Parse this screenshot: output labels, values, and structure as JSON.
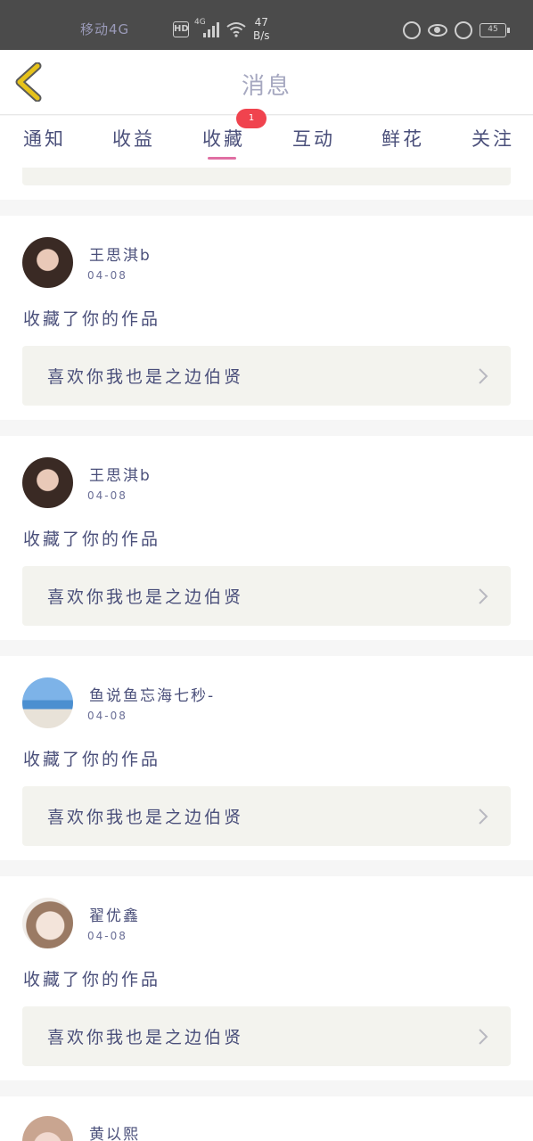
{
  "status_bar": {
    "carrier": "移动4G",
    "hd": "HD",
    "network": "4G",
    "speed_value": "47",
    "speed_unit": "B/s",
    "battery": "45"
  },
  "header": {
    "title": "消息"
  },
  "tabs": [
    {
      "label": "通知"
    },
    {
      "label": "收益"
    },
    {
      "label": "收藏",
      "active": true,
      "badge": "1"
    },
    {
      "label": "互动"
    },
    {
      "label": "鲜花"
    },
    {
      "label": "关注"
    }
  ],
  "cards": [
    {
      "username": "王思淇b",
      "date": "04-08",
      "action": "收藏了你的作品",
      "work_title": "喜欢你我也是之边伯贤"
    },
    {
      "username": "王思淇b",
      "date": "04-08",
      "action": "收藏了你的作品",
      "work_title": "喜欢你我也是之边伯贤"
    },
    {
      "username": "鱼说鱼忘海七秒-",
      "date": "04-08",
      "action": "收藏了你的作品",
      "work_title": "喜欢你我也是之边伯贤"
    },
    {
      "username": "翟优鑫",
      "date": "04-08",
      "action": "收藏了你的作品",
      "work_title": "喜欢你我也是之边伯贤"
    },
    {
      "username": "黄以熙"
    }
  ],
  "colors": {
    "accent_underline": "#e06fa3",
    "badge": "#f0434e",
    "back_chevron": "#e6c21a",
    "text": "#4a4f7a"
  }
}
